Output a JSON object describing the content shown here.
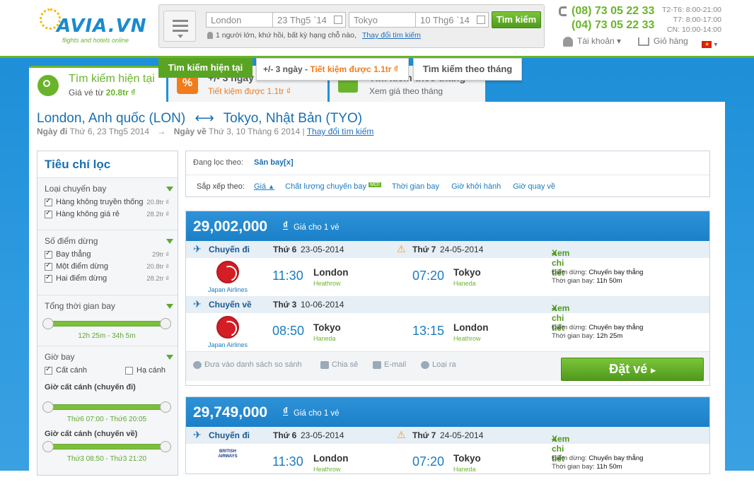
{
  "header": {
    "logo_brand": "AVIA.VN",
    "logo_tagline": "flights and hotels online",
    "search": {
      "from": "London",
      "depart_date": "23 Thg5 `14",
      "to": "Tokyo",
      "return_date": "10 Thg6 `14",
      "search_button": "Tìm kiếm",
      "summary": "1 người lớn, khứ hồi, bất kỳ hạng chỗ nào,",
      "change_link": "Thay đổi tìm kiếm"
    },
    "phone1": "(08) 73 05 22 33",
    "phone2": "(04) 73 05 22 33",
    "hours1": "T2-T6: 8:00-21:00",
    "hours2": "T7: 8:00-17:00",
    "hours3": "CN: 10:00-14:00",
    "account": "Tài khoản",
    "cart": "Giỏ hàng"
  },
  "tabs": {
    "current_title": "Tìm kiếm hiện tại",
    "current_sub_prefix": "Giá vé từ",
    "current_sub_price": "20.8tr ₫",
    "flex_title": "+/- 3 ngày",
    "flex_sub": "Tiết kiệm được 1.1tr ₫",
    "month_title": "Tìm kiếm theo tháng",
    "month_sub": "Xem giá theo tháng",
    "tooltip_current": "Tìm kiếm hiện tại",
    "tooltip_flex_prefix": "+/- 3 ngày -",
    "tooltip_flex_save": "Tiết kiệm được 1.1tr ₫",
    "tooltip_month": "Tìm kiếm theo tháng"
  },
  "route": {
    "origin": "London, Anh quốc (LON)",
    "arrow": "⟷",
    "destination": "Tokyo, Nhật Bản (TYO)",
    "depart_label": "Ngày đi",
    "depart_value": "Thứ 6, 23 Thg5 2014",
    "return_label": "Ngày về",
    "return_value": "Thứ 3, 10 Tháng 6 2014 |",
    "change_link": "Thay đổi tìm kiếm"
  },
  "filter": {
    "title": "Tiêu chí lọc",
    "airline_type": {
      "title": "Loại chuyến bay",
      "items": [
        {
          "label": "Hàng không truyền thống",
          "price": "20.8tr ₫"
        },
        {
          "label": "Hàng không giá rẻ",
          "price": "28.2tr ₫"
        }
      ]
    },
    "stops": {
      "title": "Số điểm dừng",
      "items": [
        {
          "label": "Bay thẳng",
          "price": "29tr ₫"
        },
        {
          "label": "Một điểm dừng",
          "price": "20.8tr ₫"
        },
        {
          "label": "Hai điểm dừng",
          "price": "28.2tr ₫"
        }
      ]
    },
    "duration": {
      "title": "Tổng thời gian bay",
      "range": "12h 25m - 34h 5m"
    },
    "time": {
      "title": "Giờ bay",
      "takeoff": "Cất cánh",
      "landing": "Hạ cánh",
      "out_label": "Giờ cất cánh (chuyến đi)",
      "out_range": "Thứ6 07:00 - Thứ6 20:05",
      "ret_label": "Giờ cất cánh (chuyến về)",
      "ret_range": "Thứ3 08:50 - Thứ3 21:20"
    }
  },
  "sortbar": {
    "filtering_label": "Đang lọc theo:",
    "filtering_value": "Sân bay[x]",
    "sort_label": "Sắp xếp theo:",
    "sort_price": "Giá",
    "sort_quality": "Chất lượng chuyến bay",
    "new_badge": "MỚI",
    "sort_time": "Thời gian bay",
    "sort_depart": "Giờ khởi hành",
    "sort_return": "Giờ quay về"
  },
  "results": [
    {
      "price": "29,002,000",
      "currency": "₫",
      "price_note": "Giá cho 1 vé",
      "out": {
        "label": "Chuyến đi",
        "day1": "Thứ 6",
        "date1": "23-05-2014",
        "day2": "Thứ 7",
        "date2": "24-05-2014",
        "detail": "Xem chi tiết",
        "airline": "Japan Airlines",
        "dep_time": "11:30",
        "dep_city": "London",
        "dep_airport": "Heathrow",
        "arr_time": "07:20",
        "arr_city": "Tokyo",
        "arr_airport": "Haneda",
        "stops_label": "Điểm dừng:",
        "stops": "Chuyến bay thẳng",
        "duration_label": "Thời gian bay:",
        "duration": "11h 50m"
      },
      "ret": {
        "label": "Chuyến về",
        "day1": "Thứ 3",
        "date1": "10-06-2014",
        "detail": "Xem chi tiết",
        "airline": "Japan Airlines",
        "dep_time": "08:50",
        "dep_city": "Tokyo",
        "dep_airport": "Haneda",
        "arr_time": "13:15",
        "arr_city": "London",
        "arr_airport": "Heathrow",
        "stops_label": "Điểm dừng:",
        "stops": "Chuyến bay thẳng",
        "duration_label": "Thời gian bay:",
        "duration": "12h 25m"
      },
      "actions": {
        "compare": "Đưa vào danh sách so sánh",
        "share": "Chia sẻ",
        "email": "E-mail",
        "remove": "Loại ra",
        "book": "Đặt vé"
      }
    },
    {
      "price": "29,749,000",
      "currency": "₫",
      "price_note": "Giá cho 1 vé",
      "out": {
        "label": "Chuyến đi",
        "day1": "Thứ 6",
        "date1": "23-05-2014",
        "day2": "Thứ 7",
        "date2": "24-05-2014",
        "detail": "Xem chi tiết",
        "airline_logo_text": "BRITISH AIRWAYS",
        "dep_time": "11:30",
        "dep_city": "London",
        "dep_airport": "Heathrow",
        "arr_time": "07:20",
        "arr_city": "Tokyo",
        "arr_airport": "Haneda",
        "stops_label": "Điểm dừng:",
        "stops": "Chuyến bay thẳng",
        "duration_label": "Thời gian bay:",
        "duration": "11h 50m"
      }
    }
  ]
}
